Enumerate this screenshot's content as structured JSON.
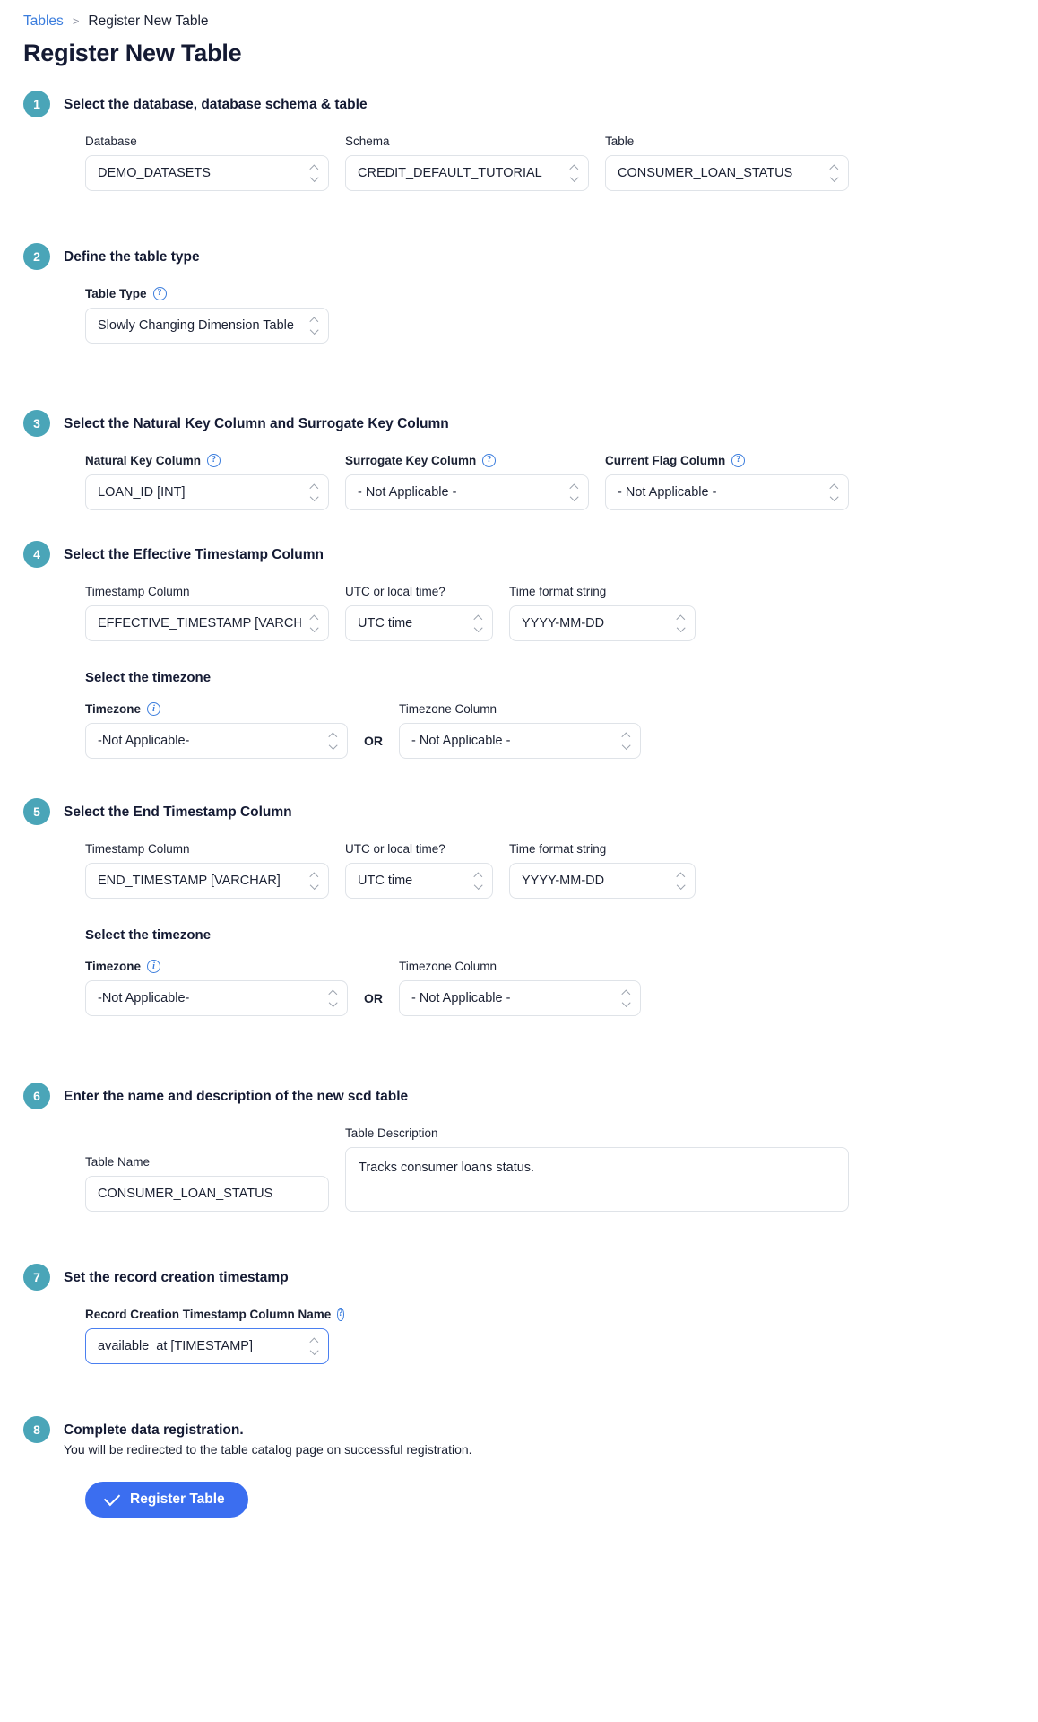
{
  "breadcrumb": {
    "root": "Tables",
    "separator": ">",
    "current": "Register New Table"
  },
  "page_title": "Register New Table",
  "icons": {
    "help": "?",
    "info": "i"
  },
  "or_label": "OR",
  "steps": [
    {
      "number": "1",
      "title": "Select the database, database schema & table",
      "fields": {
        "database": {
          "label": "Database",
          "value": "DEMO_DATASETS"
        },
        "schema": {
          "label": "Schema",
          "value": "CREDIT_DEFAULT_TUTORIAL"
        },
        "table": {
          "label": "Table",
          "value": "CONSUMER_LOAN_STATUS"
        }
      }
    },
    {
      "number": "2",
      "title": "Define the table type",
      "fields": {
        "table_type": {
          "label": "Table Type",
          "value": "Slowly Changing Dimension Table"
        }
      }
    },
    {
      "number": "3",
      "title": "Select the Natural Key Column and Surrogate Key Column",
      "fields": {
        "natural_key": {
          "label": "Natural Key Column",
          "value": "LOAN_ID [INT]"
        },
        "surrogate_key": {
          "label": "Surrogate Key Column",
          "value": "- Not Applicable -"
        },
        "current_flag": {
          "label": "Current Flag Column",
          "value": "- Not Applicable -"
        }
      }
    },
    {
      "number": "4",
      "title": "Select the Effective Timestamp Column",
      "subhead": "Select the timezone",
      "fields": {
        "timestamp_column": {
          "label": "Timestamp Column",
          "value": "EFFECTIVE_TIMESTAMP  [VARCHAR]"
        },
        "utc_or_local": {
          "label": "UTC or local time?",
          "value": "UTC time"
        },
        "time_format": {
          "label": "Time format string",
          "value": "YYYY-MM-DD"
        },
        "timezone": {
          "label": "Timezone",
          "value": "-Not Applicable-"
        },
        "timezone_column": {
          "label": "Timezone Column",
          "value": "- Not Applicable -"
        }
      }
    },
    {
      "number": "5",
      "title": "Select the End Timestamp Column",
      "subhead": "Select the timezone",
      "fields": {
        "timestamp_column": {
          "label": "Timestamp Column",
          "value": "END_TIMESTAMP  [VARCHAR]"
        },
        "utc_or_local": {
          "label": "UTC or local time?",
          "value": "UTC time"
        },
        "time_format": {
          "label": "Time format string",
          "value": "YYYY-MM-DD"
        },
        "timezone": {
          "label": "Timezone",
          "value": "-Not Applicable-"
        },
        "timezone_column": {
          "label": "Timezone Column",
          "value": "- Not Applicable -"
        }
      }
    },
    {
      "number": "6",
      "title": "Enter the name and description of the new scd table",
      "fields": {
        "table_name": {
          "label": "Table Name",
          "value": "CONSUMER_LOAN_STATUS"
        },
        "table_description": {
          "label": "Table Description",
          "value": "Tracks consumer loans status."
        }
      }
    },
    {
      "number": "7",
      "title": "Set the record creation timestamp",
      "fields": {
        "record_creation_column": {
          "label": "Record Creation Timestamp Column Name",
          "value": "available_at [TIMESTAMP]"
        }
      }
    },
    {
      "number": "8",
      "title": "Complete data registration.",
      "subtitle": "You will be redirected to the table catalog page on successful registration.",
      "submit_label": "Register Table"
    }
  ],
  "colors": {
    "step_badge": "#4aa5b8",
    "primary_button": "#3b6ef0",
    "link": "#3b7ddd",
    "help_icon": "#3b7ddd",
    "focus_border": "#4a7ff0"
  }
}
